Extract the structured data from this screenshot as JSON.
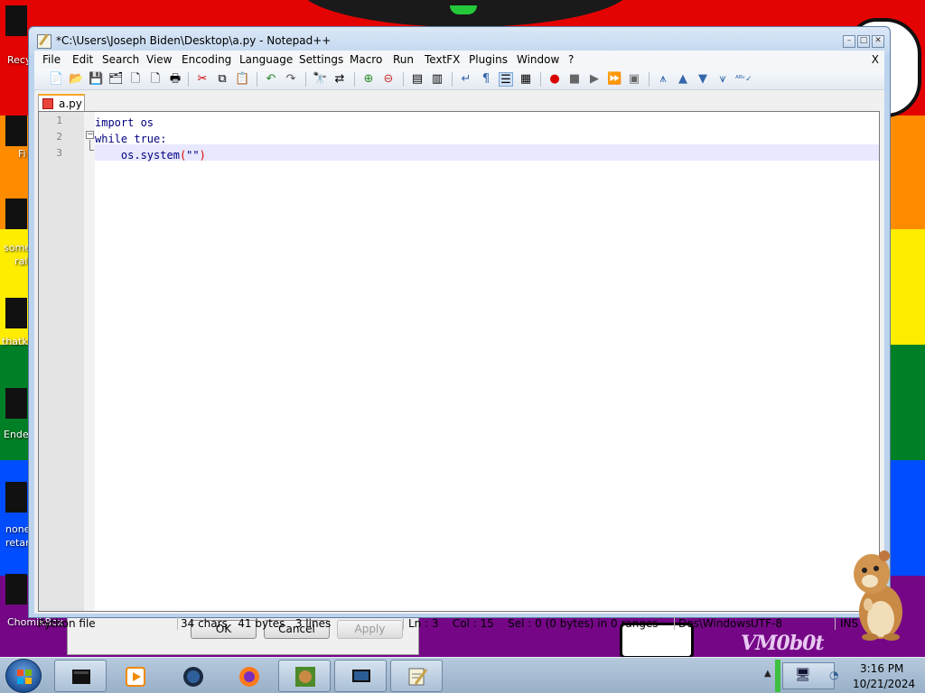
{
  "desktop": {
    "icons": [
      {
        "label": "Recy"
      },
      {
        "label": "Fi"
      },
      {
        "label": "some"
      },
      {
        "label": "ral"
      },
      {
        "label": "thatk"
      },
      {
        "label": "Ende"
      },
      {
        "label": "none"
      },
      {
        "label": "retar"
      },
      {
        "label": "ChomikBox"
      }
    ],
    "watermark": "VM0b0t"
  },
  "background_dialog": {
    "ok_label": "OK",
    "cancel_label": "Cancel",
    "apply_label": "Apply"
  },
  "window": {
    "title": "*C:\\Users\\Joseph Biden\\Desktop\\a.py - Notepad++",
    "controls": {
      "minimize": "–",
      "restore": "□",
      "close": "✕"
    }
  },
  "menu": {
    "items": [
      "File",
      "Edit",
      "Search",
      "View",
      "Encoding",
      "Language",
      "Settings",
      "Macro",
      "Run",
      "TextFX",
      "Plugins",
      "Window",
      "?"
    ],
    "close_doc": "X"
  },
  "toolbar": {
    "icons": [
      "new-file-icon",
      "open-file-icon",
      "save-icon",
      "save-all-icon",
      "close-icon",
      "close-all-icon",
      "print-icon",
      "cut-icon",
      "copy-icon",
      "paste-icon",
      "undo-icon",
      "redo-icon",
      "find-icon",
      "replace-icon",
      "zoom-in-icon",
      "zoom-out-icon",
      "sync-v-icon",
      "sync-h-icon",
      "wrap-icon",
      "show-all-chars-icon",
      "indent-guide-icon",
      "doc-map-icon",
      "record-macro-icon",
      "stop-macro-icon",
      "play-macro-icon",
      "run-macro-multiple-icon",
      "save-macro-icon",
      "fold-all-icon",
      "up-icon",
      "down-icon",
      "unfold-all-icon",
      "spellcheck-icon"
    ]
  },
  "tabs": [
    {
      "label": "a.py",
      "active": true
    }
  ],
  "editor": {
    "line_numbers": [
      "1",
      "2",
      "3"
    ],
    "lines": [
      {
        "text": "import os"
      },
      {
        "text": "while true:"
      },
      {
        "indent": "    ",
        "before": "os.system",
        "open": "(",
        "mid": "\"\"",
        "close": ")"
      }
    ],
    "fold_marker": "−"
  },
  "status": {
    "file_type": "Python file",
    "length": "34 chars   41 bytes   3 lines",
    "position": "Ln : 3    Col : 15    Sel : 0 (0 bytes) in 0 ranges",
    "eol": "Dos\\Windows",
    "encoding": "UTF-8",
    "mode": "INS"
  },
  "taskbar": {
    "time": "3:16 PM",
    "date": "10/21/2024",
    "buttons": [
      "terminal",
      "media-player",
      "unknown-app",
      "firefox",
      "chomikbox",
      "remote-desktop",
      "notepadplusplus"
    ]
  },
  "colors": {
    "keyword": "#000080",
    "brace_highlight": "#e00000",
    "current_line": "#e8e8ff",
    "tab_accent": "#f5a623"
  }
}
